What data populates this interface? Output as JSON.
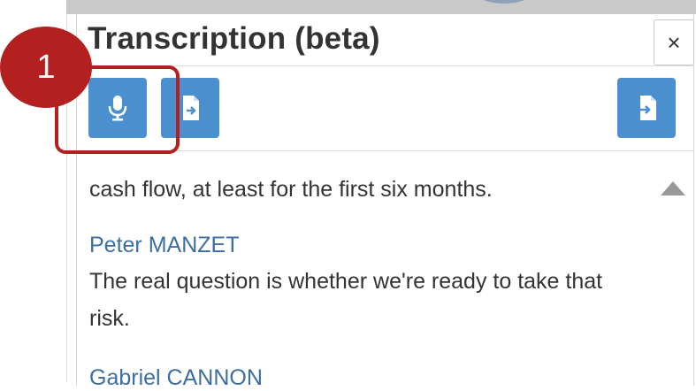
{
  "panel": {
    "title": "Transcription (beta)",
    "close_label": "×"
  },
  "toolbar": {
    "buttons": [
      {
        "name": "microphone",
        "icon": "microphone-icon"
      },
      {
        "name": "import-document",
        "icon": "document-import-icon"
      },
      {
        "name": "export-document",
        "icon": "document-export-icon"
      }
    ],
    "accent_color": "#4a8fce"
  },
  "callout": {
    "number": "1",
    "color": "#b41f1f"
  },
  "transcript": {
    "entries": [
      {
        "text": "cash flow, at least for the first six months."
      },
      {
        "speaker": "Peter MANZET",
        "text": "The real question is whether we're ready to take that risk."
      },
      {
        "speaker": "Gabriel CANNON"
      }
    ]
  }
}
